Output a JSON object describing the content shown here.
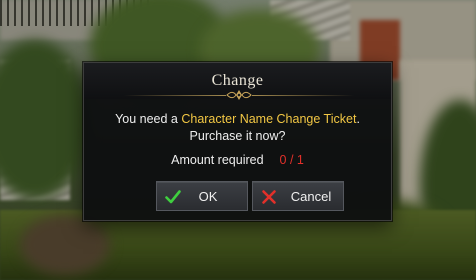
{
  "dialog": {
    "title": "Change",
    "message_prefix": "You need a ",
    "item_name": "Character Name Change Ticket",
    "message_suffix": ".",
    "question": "Purchase it now?",
    "amount_label": "Amount required",
    "amount_value": "0 / 1",
    "ok_label": "OK",
    "cancel_label": "Cancel"
  },
  "colors": {
    "item_highlight": "#f2c744",
    "amount_value": "#e2302a",
    "ok_icon": "#3fcf3f",
    "cancel_icon": "#e2302a",
    "ornament_gold": "#c9a55a"
  }
}
